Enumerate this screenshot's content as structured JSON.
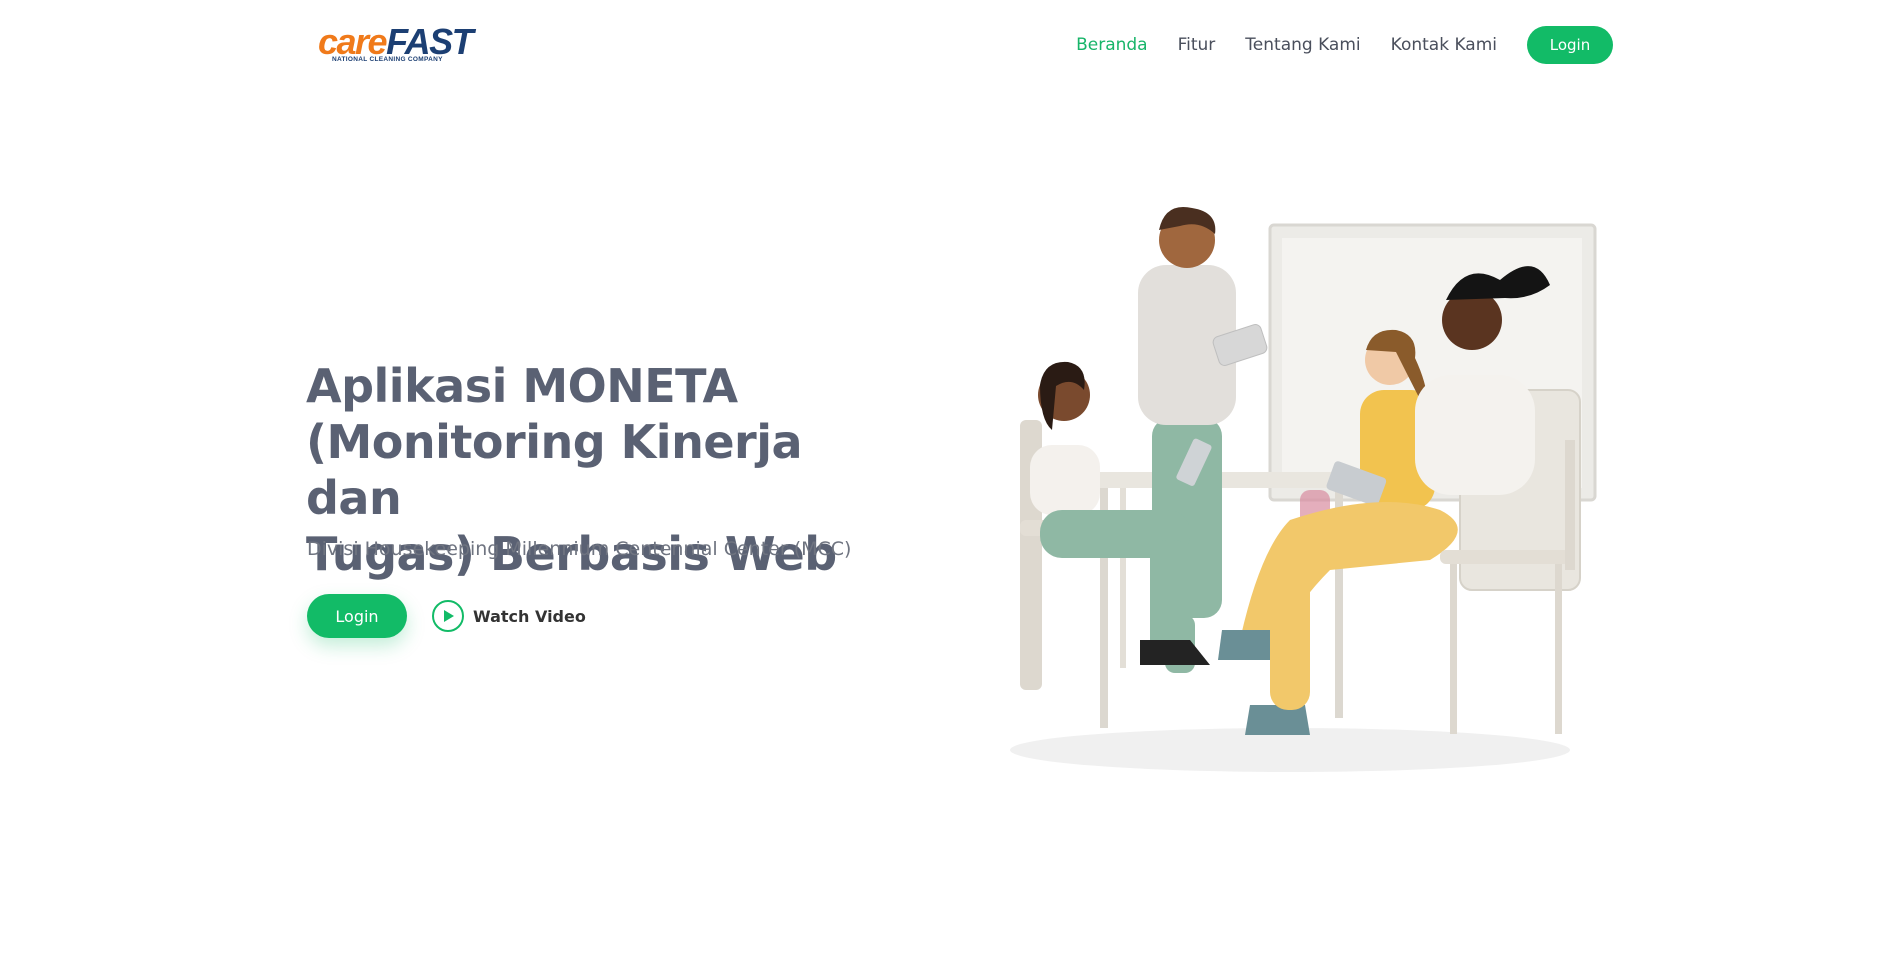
{
  "brand": {
    "name_part1": "care",
    "name_part2": "FAST",
    "tagline": "NATIONAL CLEANING COMPANY",
    "colors": {
      "orange": "#f07a1a",
      "navy": "#1c3f73"
    }
  },
  "nav": {
    "items": [
      {
        "label": "Beranda",
        "active": true
      },
      {
        "label": "Fitur",
        "active": false
      },
      {
        "label": "Tentang Kami",
        "active": false
      },
      {
        "label": "Kontak Kami",
        "active": false
      }
    ],
    "login_label": "Login"
  },
  "hero": {
    "title_lines": [
      "Aplikasi MONETA",
      "(Monitoring Kinerja dan",
      "Tugas) Berbasis Web"
    ],
    "subtitle": "Divisi Housekeeping Millennium Centennial Center (MCC)",
    "login_label": "Login",
    "watch_label": "Watch Video",
    "illustration": "team-meeting-illustration"
  },
  "colors": {
    "accent": "#12bb67",
    "heading": "#5a6173",
    "text": "#6f7480"
  }
}
